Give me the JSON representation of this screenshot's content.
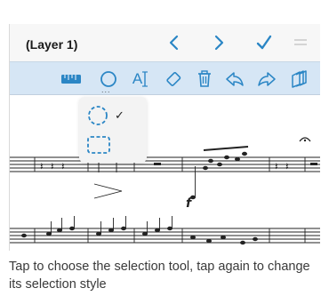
{
  "header": {
    "title": "(Layer 1)"
  },
  "toolbar": {
    "text_tool_label": "A",
    "more_indicator": "..."
  },
  "selection_popup": {
    "options": [
      {
        "icon": "circle-lasso-icon",
        "checked": true,
        "check_mark": "✓"
      },
      {
        "icon": "rectangle-select-icon",
        "checked": false
      }
    ]
  },
  "caption": {
    "text": "Tap to choose the selection tool, tap again to change its selection style"
  },
  "colors": {
    "accent": "#2b86c5",
    "toolbar_bg": "#d6e6f5",
    "titlebar_bg": "#f7f7f7"
  }
}
